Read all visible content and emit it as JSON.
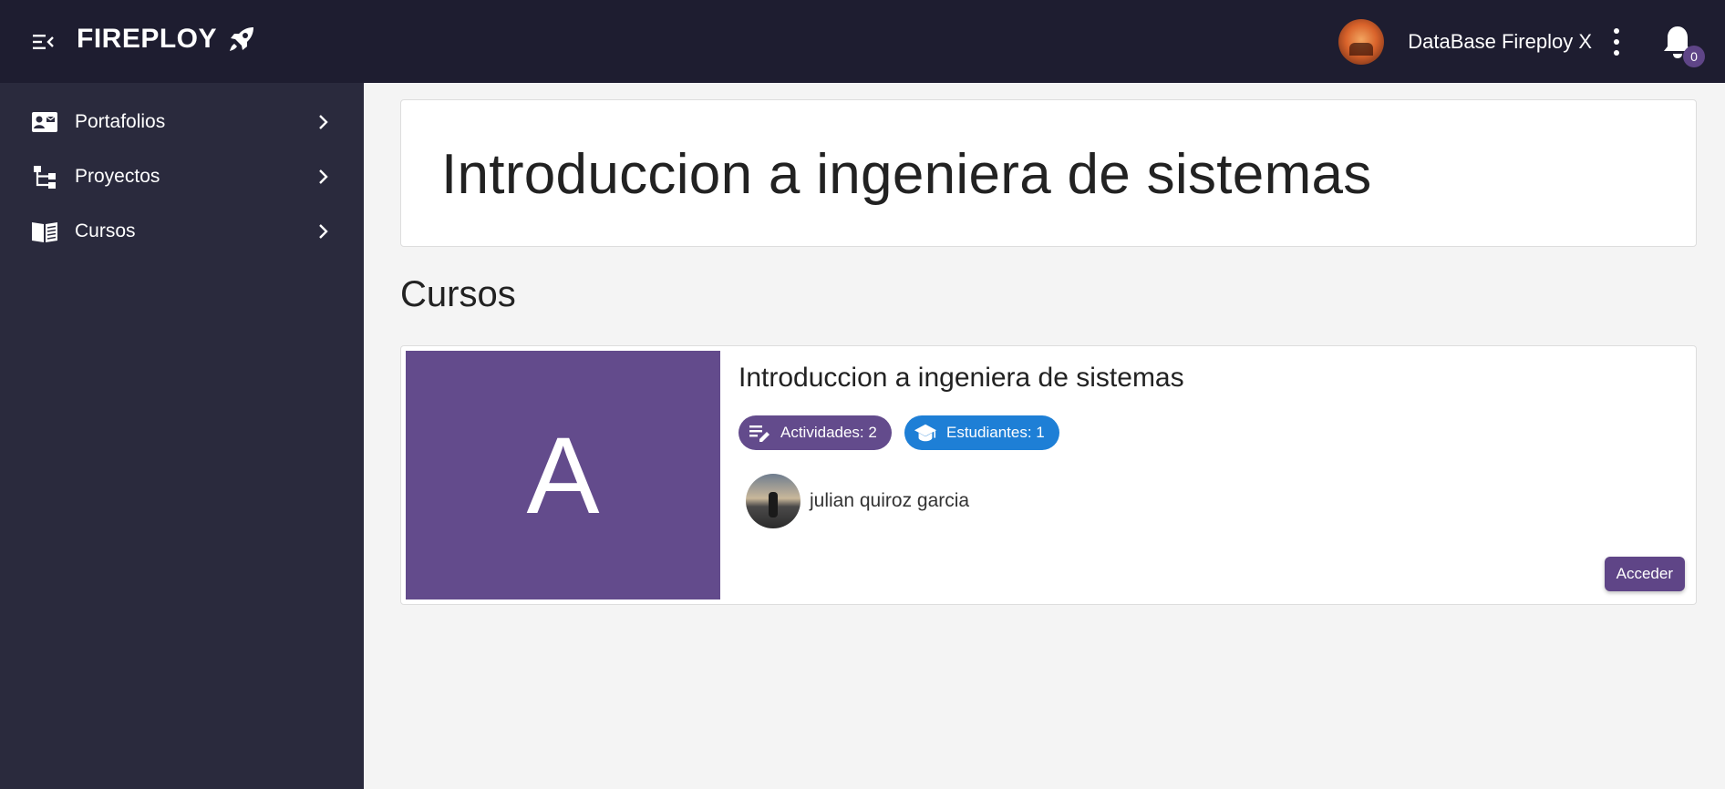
{
  "topbar": {
    "brand": "FIREPLOY",
    "user_name": "DataBase Fireploy X",
    "notification_count": "0"
  },
  "sidebar": {
    "items": [
      {
        "label": "Portafolios",
        "icon": "contact-card-icon"
      },
      {
        "label": "Proyectos",
        "icon": "tree-structure-icon"
      },
      {
        "label": "Cursos",
        "icon": "book-icon"
      }
    ]
  },
  "main": {
    "page_title": "Introduccion a ingeniera de sistemas",
    "section_title": "Cursos",
    "course": {
      "thumb_letter": "A",
      "title": "Introduccion a ingeniera de sistemas",
      "activities_label": "Actividades: 2",
      "students_label": "Estudiantes: 1",
      "member_name": "julian quiroz garcia",
      "access_label": "Acceder"
    }
  },
  "colors": {
    "topbar_bg": "#1e1d30",
    "sidebar_bg": "#2a2a3d",
    "primary_purple": "#634b8c",
    "students_blue": "#1e7fd6"
  }
}
